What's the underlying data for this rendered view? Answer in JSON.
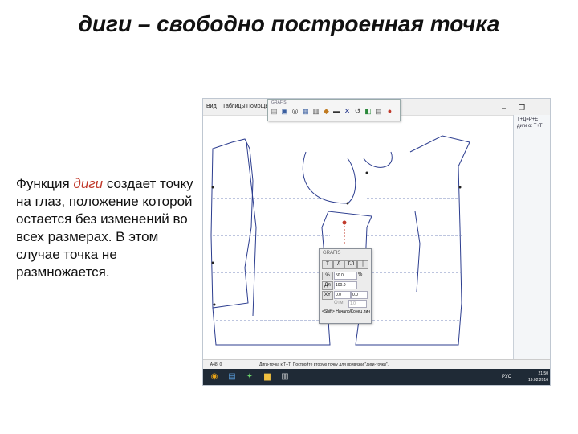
{
  "slide": {
    "title": "диги – свободно построенная точка",
    "description": {
      "part1": "Функция ",
      "highlight": "диги",
      "part2": " создает точку на глаз, положение которой остается без изменений во всех размерах. В этом случае точка не размножается."
    }
  },
  "screenshot": {
    "menubar": {
      "item1": "Вид",
      "item2": "Таблицы",
      "item3": "Помощь"
    },
    "toolbar": {
      "title": "GRAFIS"
    },
    "right_panel": {
      "line1": "Т+Д=Р+Е",
      "line2": "диги о: Т+Т"
    },
    "dialog": {
      "title": "GRAFIS",
      "buttons": [
        "Т",
        "Л",
        "Т.Л"
      ],
      "rows": [
        {
          "label": "%",
          "value": "50.0",
          "unit": "%"
        },
        {
          "label": "Дл",
          "value": "100.0",
          "unit": ""
        },
        {
          "label": "XY",
          "value": "0.0",
          "unit": "0.0"
        }
      ],
      "disabled_label": "Отм",
      "disabled_value": "1.0",
      "hint": "<Shift> Начало/Конец лин"
    },
    "status": {
      "cell1": "_A48_0",
      "message": "Диги-точка к Т+Т: Постройте вторую точку для привязки \"диги-точки\"."
    },
    "taskbar": {
      "lang": "РУС",
      "time": "21:50",
      "date": "19.02.2016"
    }
  }
}
